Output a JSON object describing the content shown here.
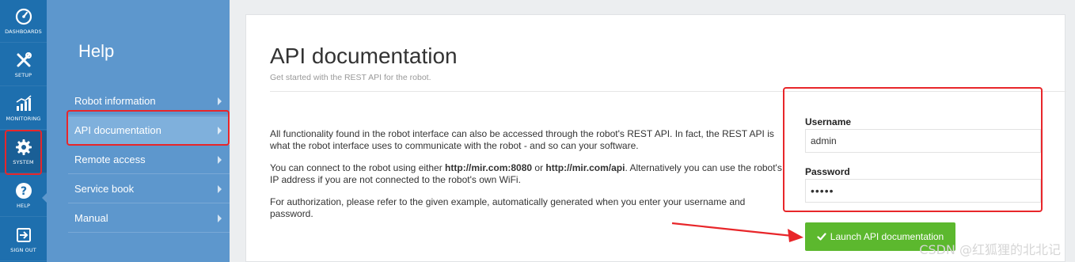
{
  "rail": {
    "items": [
      {
        "label": "DASHBOARDS",
        "icon": "speedometer-icon"
      },
      {
        "label": "SETUP",
        "icon": "tools-icon"
      },
      {
        "label": "MONITORING",
        "icon": "bar-chart-icon"
      },
      {
        "label": "SYSTEM",
        "icon": "gear-icon"
      },
      {
        "label": "HELP",
        "icon": "question-icon"
      },
      {
        "label": "SIGN OUT",
        "icon": "sign-out-icon"
      }
    ]
  },
  "submenu": {
    "title": "Help",
    "items": [
      {
        "label": "Robot information"
      },
      {
        "label": "API documentation"
      },
      {
        "label": "Remote access"
      },
      {
        "label": "Service book"
      },
      {
        "label": "Manual"
      }
    ]
  },
  "page": {
    "title": "API documentation",
    "subtitle": "Get started with the REST API for the robot.",
    "para1": "All functionality found in the robot interface can also be accessed through the robot's REST API. In fact, the REST API is what the robot interface uses to communicate with the robot - and so can your software.",
    "para2_prefix": "You can connect to the robot using either ",
    "para2_url1": "http://mir.com:8080",
    "para2_or": " or ",
    "para2_url2": "http://mir.com/api",
    "para2_suffix": ". Alternatively you can use the robot's IP address if you are not connected to the robot's own WiFi.",
    "para3": "For authorization, please refer to the given example, automatically generated when you enter your username and password."
  },
  "form": {
    "username_label": "Username",
    "username_value": "admin",
    "password_label": "Password",
    "password_value": "•••••",
    "launch_label": "Launch API documentation"
  },
  "colors": {
    "rail": "#1e6fae",
    "submenu": "#5d97cd",
    "submenu_selected": "#7fb0dc",
    "launch_button": "#5cb82e",
    "highlight": "#e8262a"
  },
  "watermark": "CSDN @红狐狸的北北记"
}
